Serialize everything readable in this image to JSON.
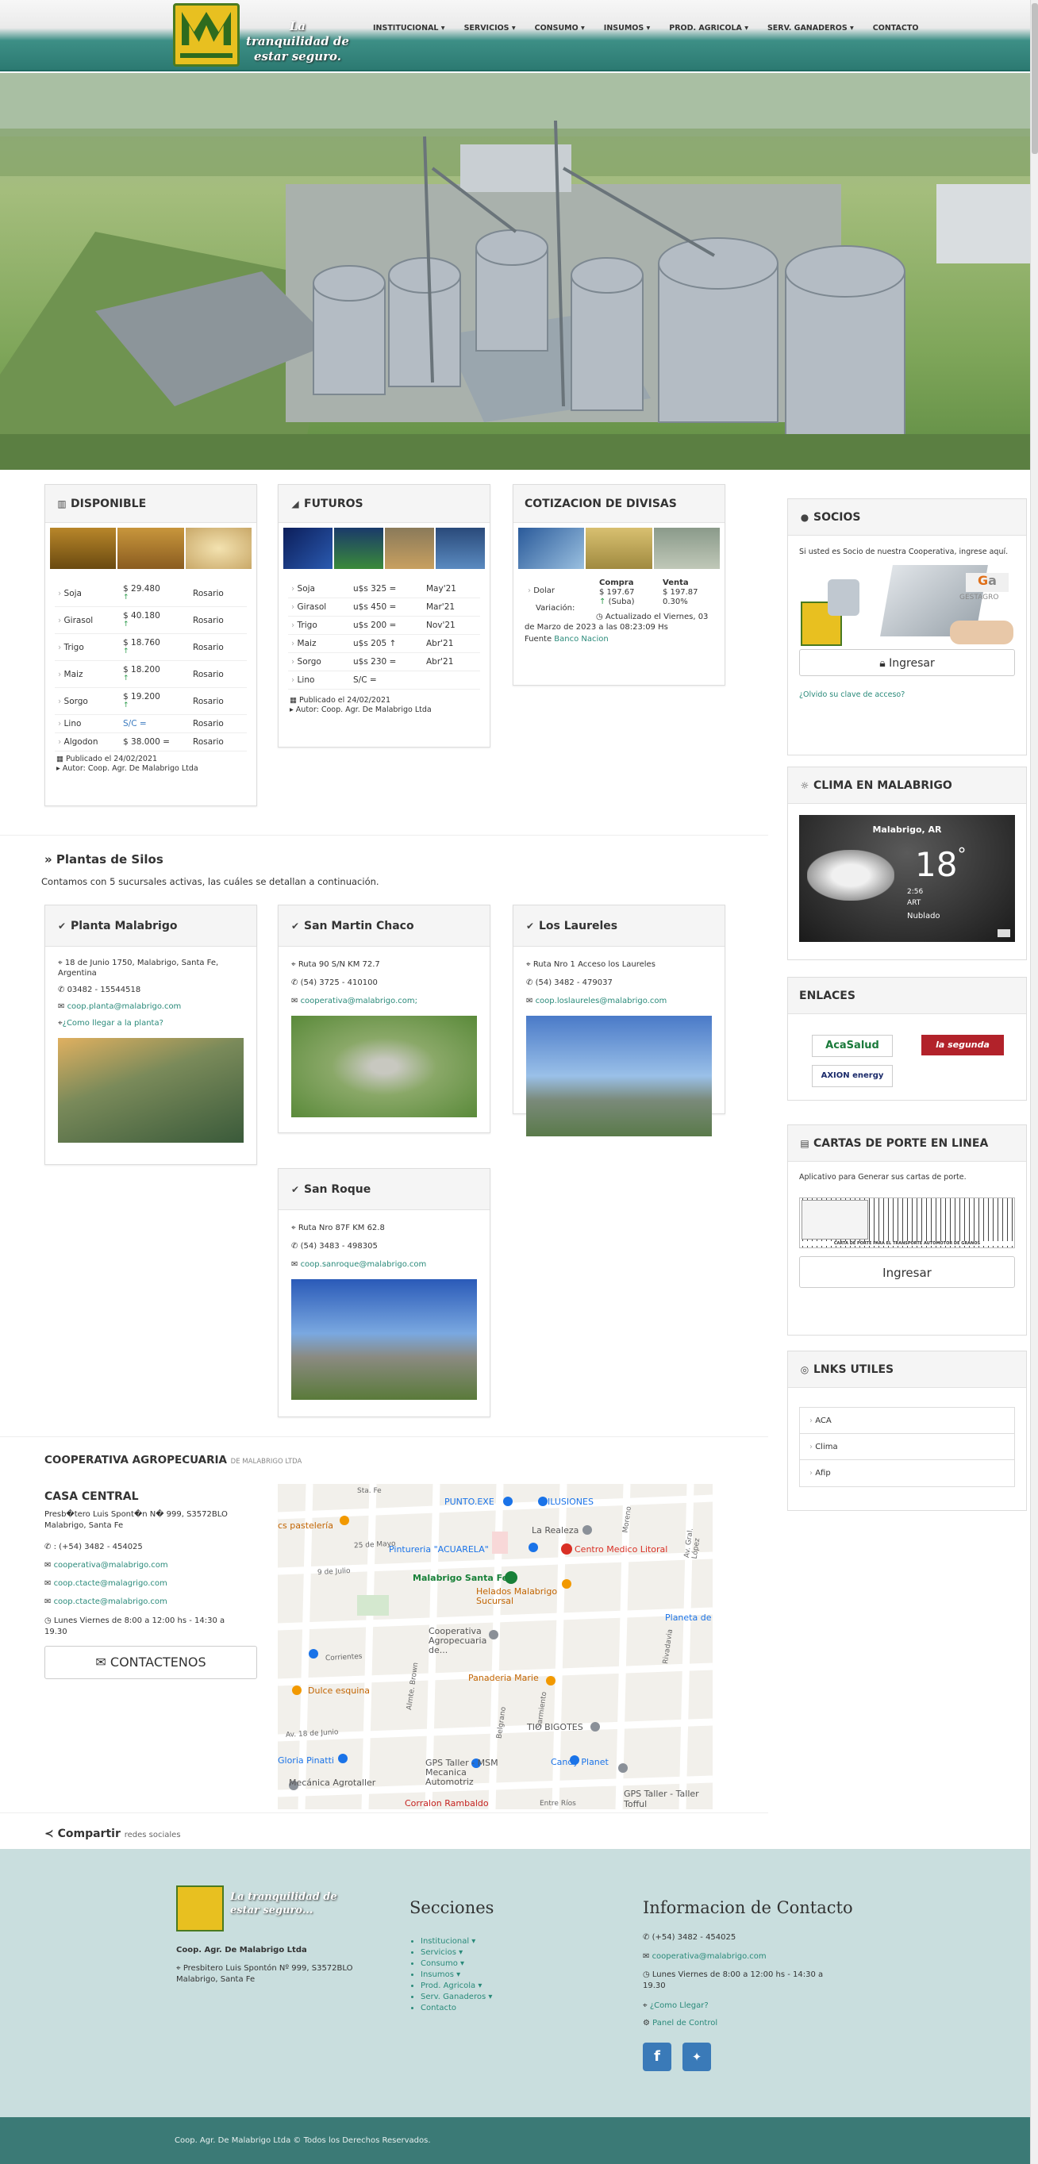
{
  "header": {
    "tagline": "La tranquilidad de estar seguro.",
    "nav": [
      "INSTITUCIONAL ▾",
      "SERVICIOS ▾",
      "CONSUMO ▾",
      "INSUMOS ▾",
      "PROD. AGRICOLA ▾",
      "SERV. GANADEROS ▾",
      "CONTACTO"
    ]
  },
  "disponible": {
    "title": "DISPONIBLE",
    "rows": [
      {
        "name": "Soja",
        "price": "$ 29.480",
        "trend": "up",
        "place": "Rosario"
      },
      {
        "name": "Girasol",
        "price": "$ 40.180",
        "trend": "up",
        "place": "Rosario"
      },
      {
        "name": "Trigo",
        "price": "$ 18.760",
        "trend": "up",
        "place": "Rosario"
      },
      {
        "name": "Maiz",
        "price": "$ 18.200",
        "trend": "up",
        "place": "Rosario"
      },
      {
        "name": "Sorgo",
        "price": "$ 19.200",
        "trend": "up",
        "place": "Rosario"
      },
      {
        "name": "Lino",
        "price": "S/C =",
        "trend": "eq",
        "place": "Rosario"
      },
      {
        "name": "Algodon",
        "price": "$ 38.000 =",
        "trend": "eq",
        "place": "Rosario"
      }
    ],
    "published": "Publicado el 24/02/2021",
    "author": "Autor: Coop. Agr. De Malabrigo Ltda"
  },
  "futuros": {
    "title": "FUTUROS",
    "rows": [
      {
        "name": "Soja",
        "price": "u$s 325 =",
        "month": "May'21"
      },
      {
        "name": "Girasol",
        "price": "u$s 450 =",
        "month": "Mar'21"
      },
      {
        "name": "Trigo",
        "price": "u$s 200 =",
        "month": "Nov'21"
      },
      {
        "name": "Maiz",
        "price": "u$s 205 ↑",
        "month": "Abr'21"
      },
      {
        "name": "Sorgo",
        "price": "u$s 230 =",
        "month": "Abr'21"
      },
      {
        "name": "Lino",
        "price": "S/C =",
        "month": ""
      }
    ],
    "published": "Publicado el 24/02/2021",
    "author": "Autor: Coop. Agr. De Malabrigo Ltda"
  },
  "divisas": {
    "title": "COTIZACION DE DIVISAS",
    "col_buy": "Compra",
    "col_sell": "Venta",
    "row_label": "Dolar",
    "buy": "$ 197.67",
    "sell": "$ 197.87",
    "var_label": "Variación:",
    "var_trend": "(Suba)",
    "var_value": "0.30%",
    "updated": "Actualizado el Viernes, 03 de Marzo de 2023 a las 08:23:09 Hs",
    "source_label": "Fuente",
    "source_link": "Banco Nacion"
  },
  "plantas": {
    "title": "Plantas de Silos",
    "intro": "Contamos con 5  sucursales activas, las cuáles se detallan a continuación.",
    "items": [
      {
        "name": "Planta Malabrigo",
        "address": "18 de Junio 1750, Malabrigo, Santa Fe, Argentina",
        "phone": "03482 - 15544518",
        "email": "coop.planta@malabrigo.com",
        "link": "¿Como llegar a la planta?"
      },
      {
        "name": "San Martin Chaco",
        "address": "Ruta 90 S/N KM 72.7",
        "phone": "(54) 3725 - 410100",
        "email": "cooperativa@malabrigo.com;"
      },
      {
        "name": "Los Laureles",
        "address": "Ruta Nro 1 Acceso los Laureles",
        "phone": "(54) 3482 - 479037",
        "email": "coop.loslaureles@malabrigo.com"
      },
      {
        "name": "San Roque",
        "address": "Ruta Nro 87F KM 62.8",
        "phone": "(54) 3483 - 498305",
        "email": "coop.sanroque@malabrigo.com"
      }
    ]
  },
  "cooperativa": {
    "title": "COOPERATIVA AGROPECUARIA",
    "subtitle": "DE MALABRIGO LTDA",
    "casa": "CASA CENTRAL",
    "address": "Presb�tero Luis Spont�n N� 999, S3572BLO Malabrigo, Santa Fe",
    "phone": ": (+54) 3482 - 454025",
    "emails": [
      "cooperativa@malabrigo.com",
      "coop.ctacte@malagrigo.com",
      "coop.ctacte@malabrigo.com"
    ],
    "hours": "Lunes Viernes de 8:00 a 12:00 hs - 14:30 a 19.30",
    "contact_button": "CONTACTENOS"
  },
  "map": {
    "labels": [
      "Sta. Fe",
      "PUNTO.EXE",
      "ILUSIONES",
      "cs pastelería",
      "La Realeza",
      "Pintureria \"ACUARELA\"",
      "Centro Medico Litoral",
      "Malabrigo Santa Fe",
      "Helados Malabrigo Sucursal",
      "Cooperativa Agropecuaria de...",
      "Planeta de",
      "Panaderia Marie",
      "Dulce esquina",
      "TIO BIGOTES",
      "Gloria Pinatti",
      "GPS Taller - MSM Mecanica Automotriz",
      "Candy Planet",
      "Mecánica Agrotaller",
      "GPS Taller - Taller Tofful",
      "Corralon Rambaldo"
    ],
    "streets": [
      "25 de Mayo",
      "9 de Julio",
      "Corrientes",
      "Av. 18 de Junio",
      "Moreno",
      "Rivadavia",
      "Av. Gral. López",
      "Belgrano",
      "Sarmiento",
      "Almte. Brown",
      "Entre Ríos"
    ]
  },
  "sidebar": {
    "socios": {
      "title": "SOCIOS",
      "text": "Si usted es Socio de nuestra Cooperativa, ingrese aquí.",
      "brand": "GESTAGRO",
      "button": "Ingresar",
      "forgot": "¿Olvido su clave de acceso?"
    },
    "clima": {
      "title": "CLIMA EN MALABRIGO",
      "city": "Malabrigo, AR",
      "temp": "18",
      "time": "2:56",
      "tz": "ART",
      "condition": "Nublado"
    },
    "enlaces": {
      "title": "ENLACES",
      "logos": [
        "AcaSalud",
        "la segunda",
        "AXION energy"
      ]
    },
    "cartas": {
      "title": "CARTAS DE PORTE EN LINEA",
      "text": "Aplicativo para Generar sus cartas de porte.",
      "doc_title": "CARTA DE PORTE PARA EL TRANSPORTE AUTOMOTOR DE GRANOS",
      "button": "Ingresar"
    },
    "links": {
      "title": "LNKS UTILES",
      "items": [
        "ACA",
        "Clima",
        "Afip"
      ]
    }
  },
  "share": {
    "label": "Compartir",
    "sub": "redes sociales"
  },
  "footer": {
    "tagline": "La tranquilidad de estar seguro...",
    "company": "Coop. Agr. De Malabrigo Ltda",
    "address": "Presbitero Luis Spontón Nº 999, S3572BLO Malabrigo, Santa Fe",
    "sections_title": "Secciones",
    "sections": [
      "Institucional ▾",
      "Servicios ▾",
      "Consumo ▾",
      "Insumos ▾",
      "Prod. Agricola ▾",
      "Serv. Ganaderos ▾",
      "Contacto"
    ],
    "contact_title": "Informacion de Contacto",
    "phone": "(+54) 3482 - 454025",
    "email": "cooperativa@malabrigo.com",
    "hours": "Lunes Viernes de 8:00 a 12:00 hs - 14:30 a 19.30",
    "como_llegar": "¿Como Llegar?",
    "panel": "Panel de Control",
    "copyright": "Coop. Agr. De Malabrigo Ltda © Todos los Derechos Reservados."
  }
}
